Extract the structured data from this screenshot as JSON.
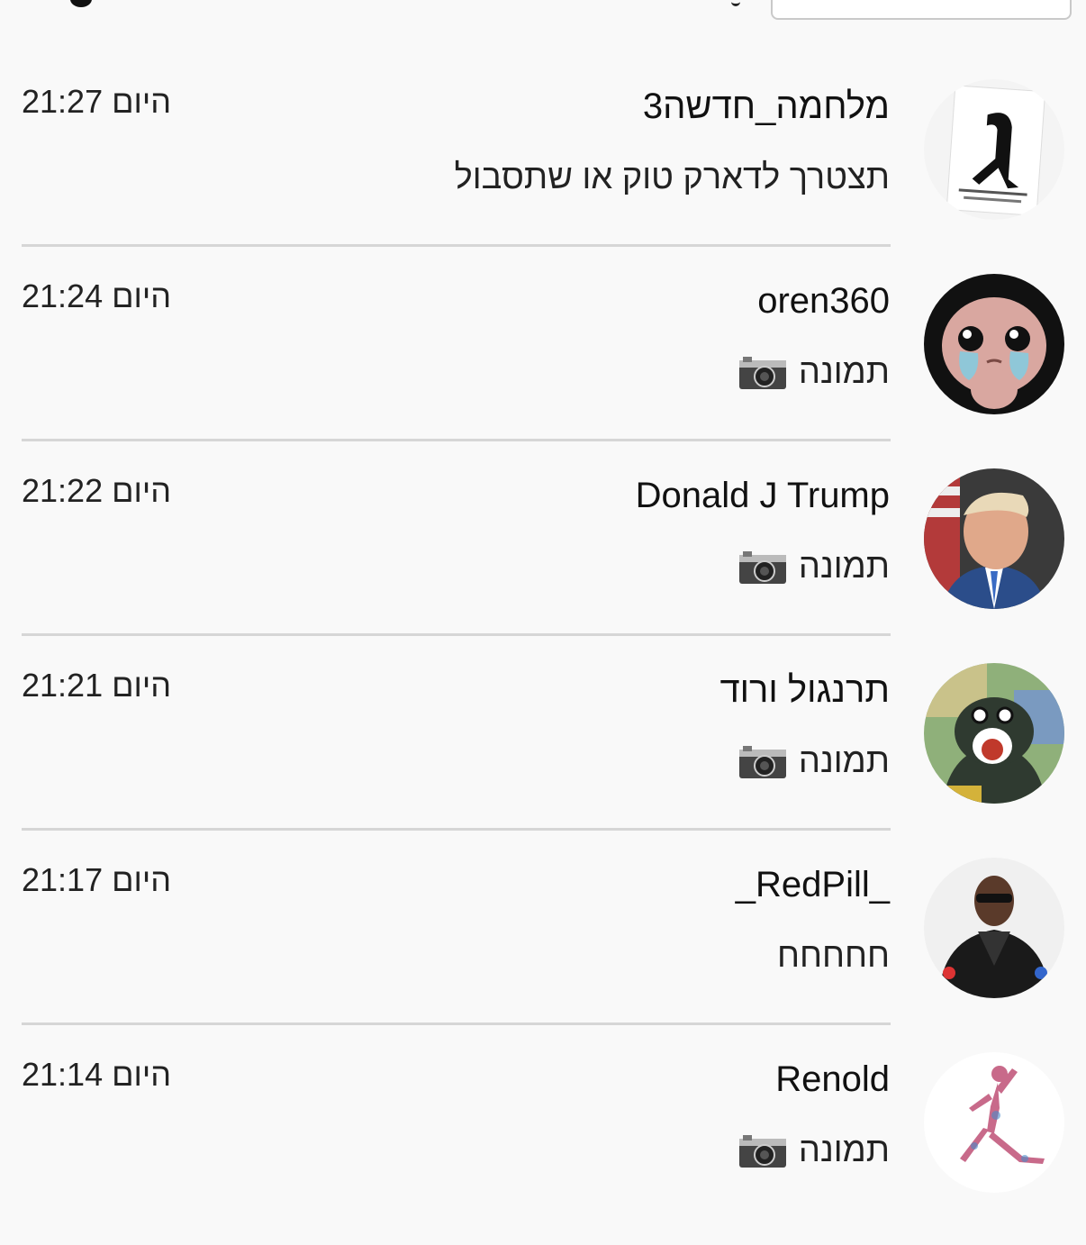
{
  "chats": [
    {
      "name": "מלחמה_חדשה3",
      "preview": "תצטרך לדארק טוק או שתסבול",
      "has_photo": false,
      "time": "היום 21:27",
      "avatar": "gimel-logo"
    },
    {
      "name": "oren360",
      "preview": "תמונה",
      "has_photo": true,
      "time": "היום 21:24",
      "avatar": "crying-character"
    },
    {
      "name": "Donald J Trump",
      "preview": "תמונה",
      "has_photo": true,
      "time": "היום 21:22",
      "avatar": "portrait-photo"
    },
    {
      "name": "תרנגול ורוד",
      "preview": "תמונה",
      "has_photo": true,
      "time": "היום 21:21",
      "avatar": "cartoon-cat"
    },
    {
      "name": "_RedPill_",
      "preview": "חחחחח",
      "has_photo": false,
      "time": "היום 21:17",
      "avatar": "matrix-man"
    },
    {
      "name": "Renold",
      "preview": "תמונה",
      "has_photo": true,
      "time": "היום 21:14",
      "avatar": "jumpman-logo"
    }
  ]
}
